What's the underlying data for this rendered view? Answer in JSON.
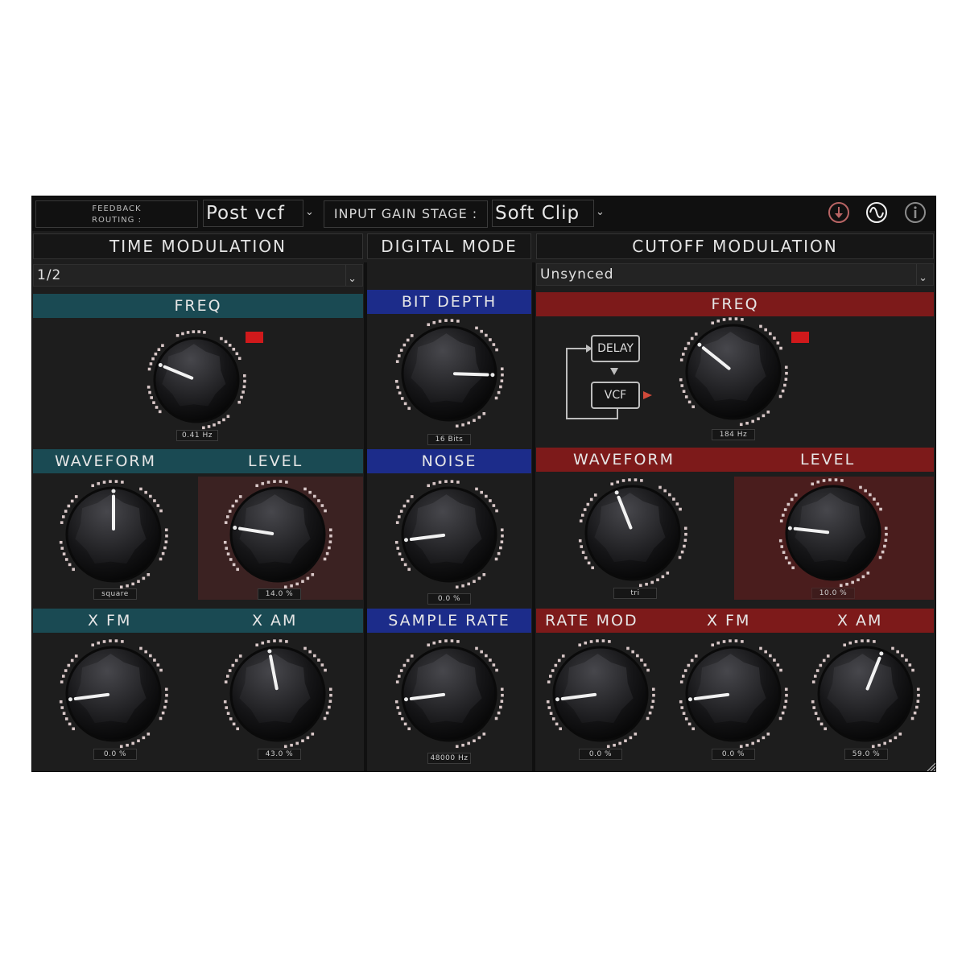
{
  "topbar": {
    "feedback_routing_label_line1": "FEEDBACK",
    "feedback_routing_label_line2": "ROUTING :",
    "feedback_routing_value": "Post vcf",
    "input_gain_label": "INPUT GAIN STAGE :",
    "input_gain_value": "Soft Clip",
    "icons": [
      "download-icon",
      "sine-wave-icon",
      "info-icon"
    ]
  },
  "colors": {
    "time_mod": "#1a4a53",
    "digital": "#1c2c8a",
    "cutoff_mod": "#7d1a1a",
    "led": "#d0191b"
  },
  "time_modulation": {
    "title": "TIME MODULATION",
    "sync_value": "1/2",
    "freq": {
      "label": "FREQ",
      "value": "0.41 Hz",
      "position": 0.25
    },
    "waveform": {
      "label": "WAVEFORM",
      "value": "square",
      "position": 0.5
    },
    "level": {
      "label": "LEVEL",
      "value": "14.0 %",
      "position": 0.2
    },
    "xfm": {
      "label": "X FM",
      "value": "0.0 %",
      "position": 0.14
    },
    "xam": {
      "label": "X AM",
      "value": "43.0 %",
      "position": 0.46
    }
  },
  "digital_mode": {
    "title": "DIGITAL MODE",
    "bit_depth": {
      "label": "BIT DEPTH",
      "value": "16 Bits",
      "position": 0.84
    },
    "noise": {
      "label": "NOISE",
      "value": "0.0 %",
      "position": 0.14
    },
    "sample_rate": {
      "label": "SAMPLE RATE",
      "value": "48000 Hz",
      "position": 0.14
    }
  },
  "cutoff_modulation": {
    "title": "CUTOFF MODULATION",
    "sync_value": "Unsynced",
    "freq": {
      "label": "FREQ",
      "value": "184 Hz",
      "position": 0.31
    },
    "routing_diagram": {
      "delay_label": "DELAY",
      "vcf_label": "VCF"
    },
    "waveform": {
      "label": "WAVEFORM",
      "value": "tri",
      "position": 0.42
    },
    "level": {
      "label": "LEVEL",
      "value": "10.0 %",
      "position": 0.19
    },
    "rate_mod": {
      "label": "RATE MOD",
      "value": "0.0 %",
      "position": 0.14
    },
    "xfm": {
      "label": "X FM",
      "value": "0.0 %",
      "position": 0.14
    },
    "xam": {
      "label": "X AM",
      "value": "59.0 %",
      "position": 0.58
    }
  }
}
